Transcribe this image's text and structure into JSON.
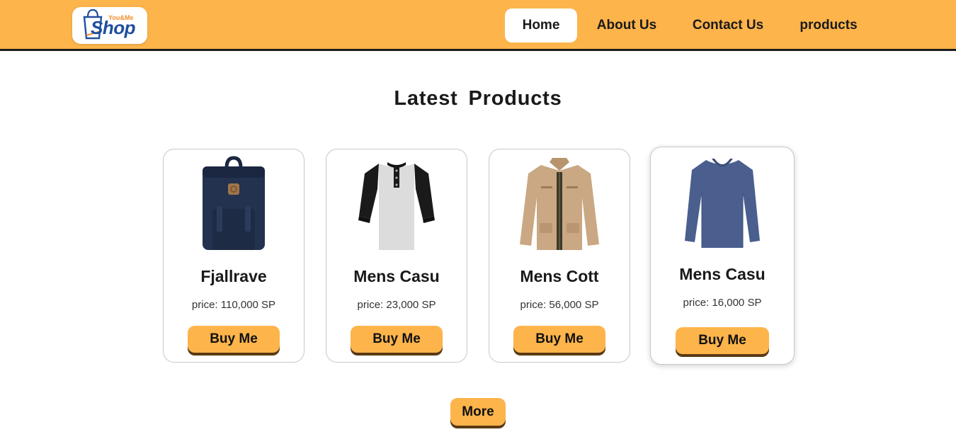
{
  "header": {
    "logo_top": "You&Me",
    "logo_main": "Shop",
    "nav": [
      {
        "label": "Home",
        "active": true
      },
      {
        "label": "About Us",
        "active": false
      },
      {
        "label": "Contact Us",
        "active": false
      },
      {
        "label": "products",
        "active": false
      }
    ]
  },
  "main": {
    "title": "Latest  Products",
    "products": [
      {
        "name": "Fjallrave",
        "price": "price: 110,000 SP",
        "button": "Buy Me",
        "image": "backpack-image"
      },
      {
        "name": "Mens Casu",
        "price": "price: 23,000 SP",
        "button": "Buy Me",
        "image": "raglan-tshirt-image"
      },
      {
        "name": "Mens Cott",
        "price": "price: 56,000 SP",
        "button": "Buy Me",
        "image": "cotton-jacket-image"
      },
      {
        "name": "Mens Casu",
        "price": "price: 16,000 SP",
        "button": "Buy Me",
        "image": "slim-fit-shirt-image"
      }
    ],
    "more_label": "More"
  },
  "colors": {
    "accent": "#fdb44b",
    "button_shadow": "#5a3a14",
    "logo_blue": "#1f4fa0",
    "logo_orange": "#f28c28"
  }
}
